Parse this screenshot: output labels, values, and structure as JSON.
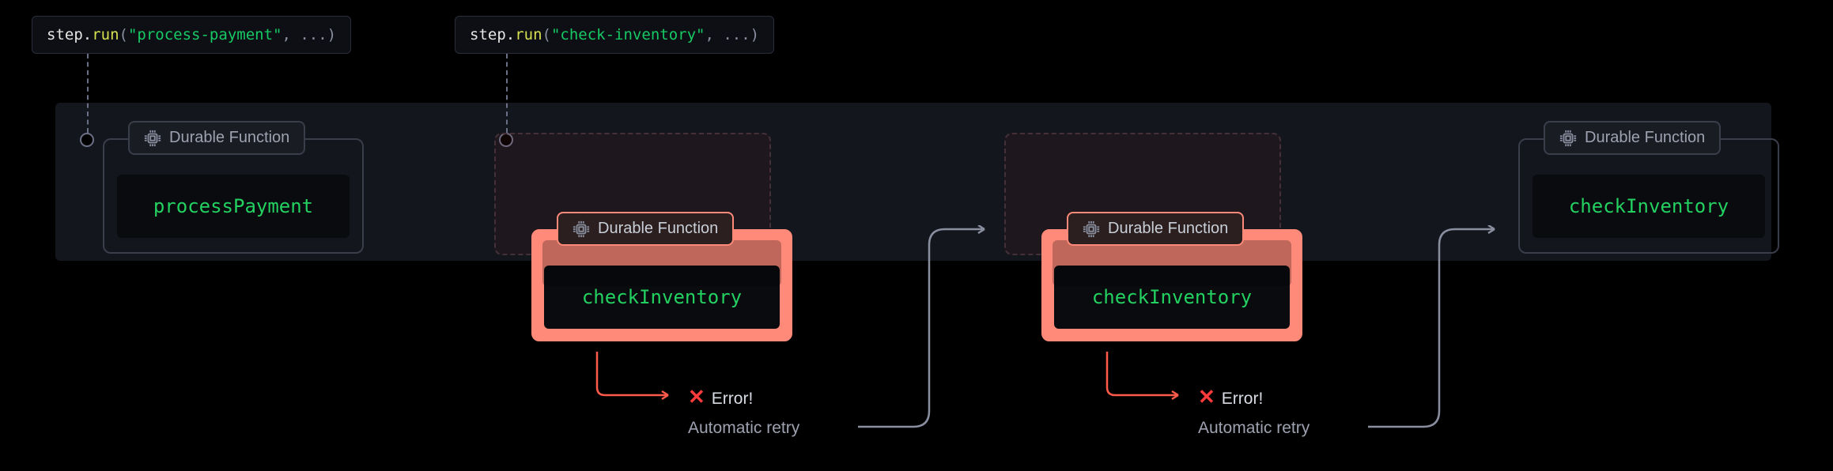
{
  "badge_label": "Durable Function",
  "code_tips": {
    "payment": {
      "prefix": "step.",
      "method": "run",
      "open": "(",
      "arg_string": "\"process-payment\"",
      "rest": ", ...)"
    },
    "inventory": {
      "prefix": "step.",
      "method": "run",
      "open": "(",
      "arg_string": "\"check-inventory\"",
      "rest": ", ...)"
    }
  },
  "functions": {
    "processPayment": "processPayment",
    "checkInventory": "checkInventory"
  },
  "error": {
    "label": "Error!",
    "retry": "Automatic retry"
  }
}
